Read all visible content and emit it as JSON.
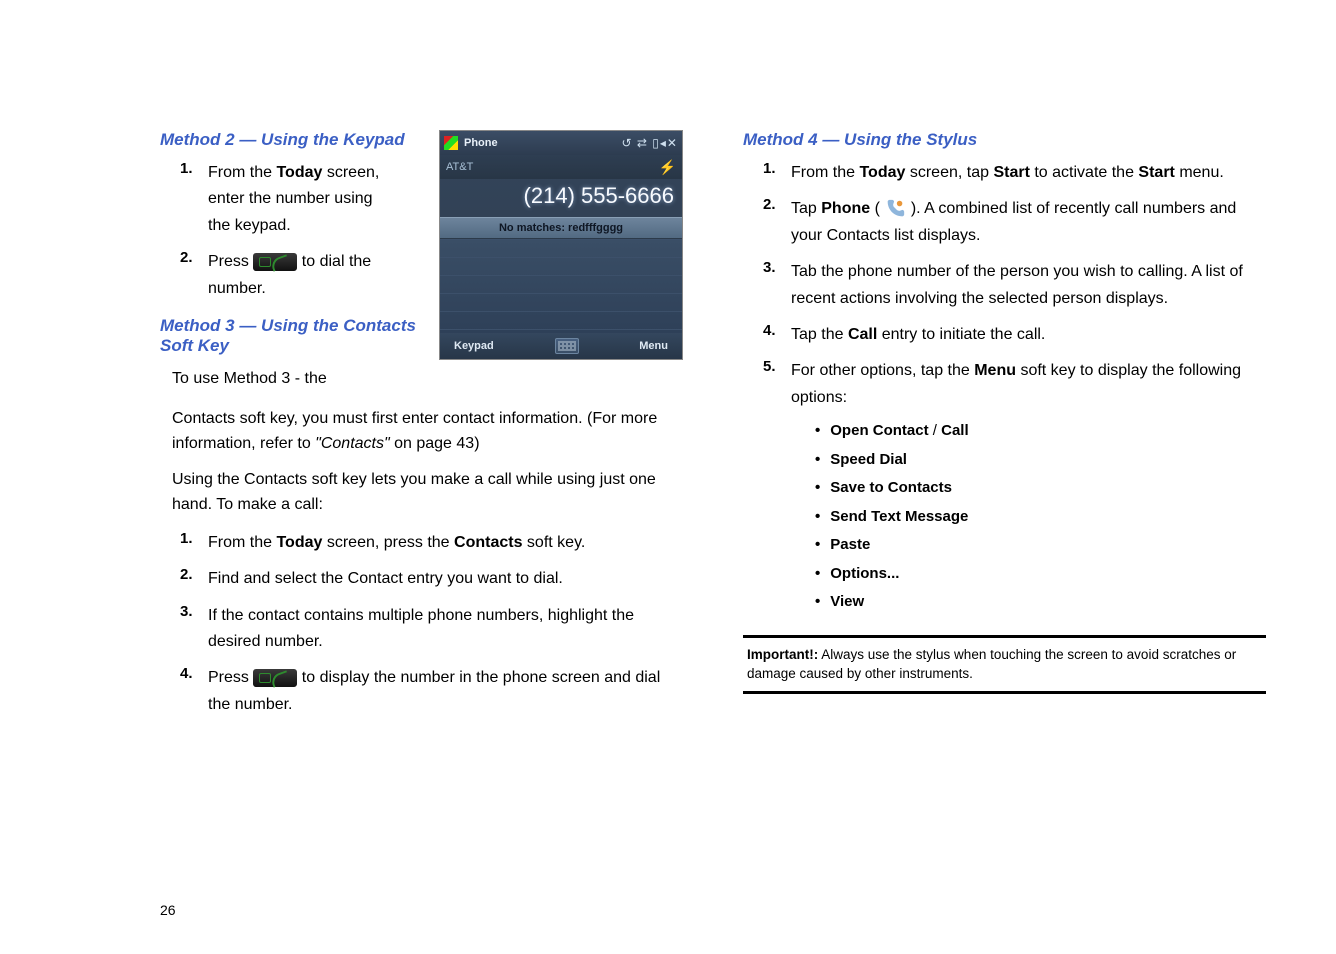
{
  "left": {
    "method2": {
      "heading": "Method 2 — Using the Keypad",
      "step1_pre": "From the ",
      "step1_b": "Today",
      "step1_post": " screen, enter the number using the keypad.",
      "step2_pre": "Press ",
      "step2_post": " to dial the number."
    },
    "method3": {
      "heading": "Method 3 — Using the Contacts Soft Key",
      "intro": "To use Method 3 - the",
      "para1": "Contacts soft key, you must first enter contact information. (For more information, refer to ",
      "para1_em": "\"Contacts\"",
      "para1_post": "  on page 43)",
      "para2": "Using the Contacts soft key lets you make a call while using just one hand. To make a call:",
      "step1_pre": "From the ",
      "step1_b1": "Today",
      "step1_mid": " screen, press the ",
      "step1_b2": "Contacts",
      "step1_post": " soft key.",
      "step2": "Find and select the Contact entry you want to dial.",
      "step3": "If the contact contains multiple phone numbers, highlight the desired number.",
      "step4_pre": "Press ",
      "step4_post": " to display the number in the phone screen and dial the number."
    },
    "screenshot": {
      "title": "Phone",
      "status_icons": "↺ ⇄ ▯◂✕",
      "carrier": "AT&T",
      "number": "(214) 555-6666",
      "nomatch": "No matches: redfffgggg",
      "left_key": "Keypad",
      "right_key": "Menu"
    },
    "nums": {
      "n1": "1.",
      "n2": "2.",
      "n3": "3.",
      "n4": "4."
    }
  },
  "right": {
    "method4": {
      "heading": "Method 4 — Using the Stylus",
      "step1_pre": "From the ",
      "step1_b1": "Today",
      "step1_mid": " screen, tap ",
      "step1_b2": "Start",
      "step1_mid2": " to activate the ",
      "step1_b3": "Start",
      "step1_post": " menu.",
      "step2_pre": "Tap ",
      "step2_b": "Phone",
      "step2_mid": " (",
      "step2_post": "). A combined list of recently call numbers and your Contacts list displays.",
      "step3": "Tab the phone number of the person you wish to calling. A list of recent actions involving the selected person displays.",
      "step4_pre": "Tap the ",
      "step4_b": "Call",
      "step4_post": " entry to initiate the call.",
      "step5_pre": "For other options, tap the ",
      "step5_b": "Menu",
      "step5_post": " soft key to display the following options:",
      "bullets": {
        "b1a": "Open Contact",
        "b1sep": " / ",
        "b1b": "Call",
        "b2": "Speed Dial",
        "b3": "Save to Contacts",
        "b4": "Send Text Message",
        "b5": "Paste",
        "b6": "Options...",
        "b7": "View"
      }
    },
    "important": {
      "label": "Important!:",
      "text": " Always use the stylus when touching the screen to avoid scratches or damage caused by other instruments."
    },
    "nums": {
      "n1": "1.",
      "n2": "2.",
      "n3": "3.",
      "n4": "4.",
      "n5": "5."
    }
  },
  "page_number": "26"
}
